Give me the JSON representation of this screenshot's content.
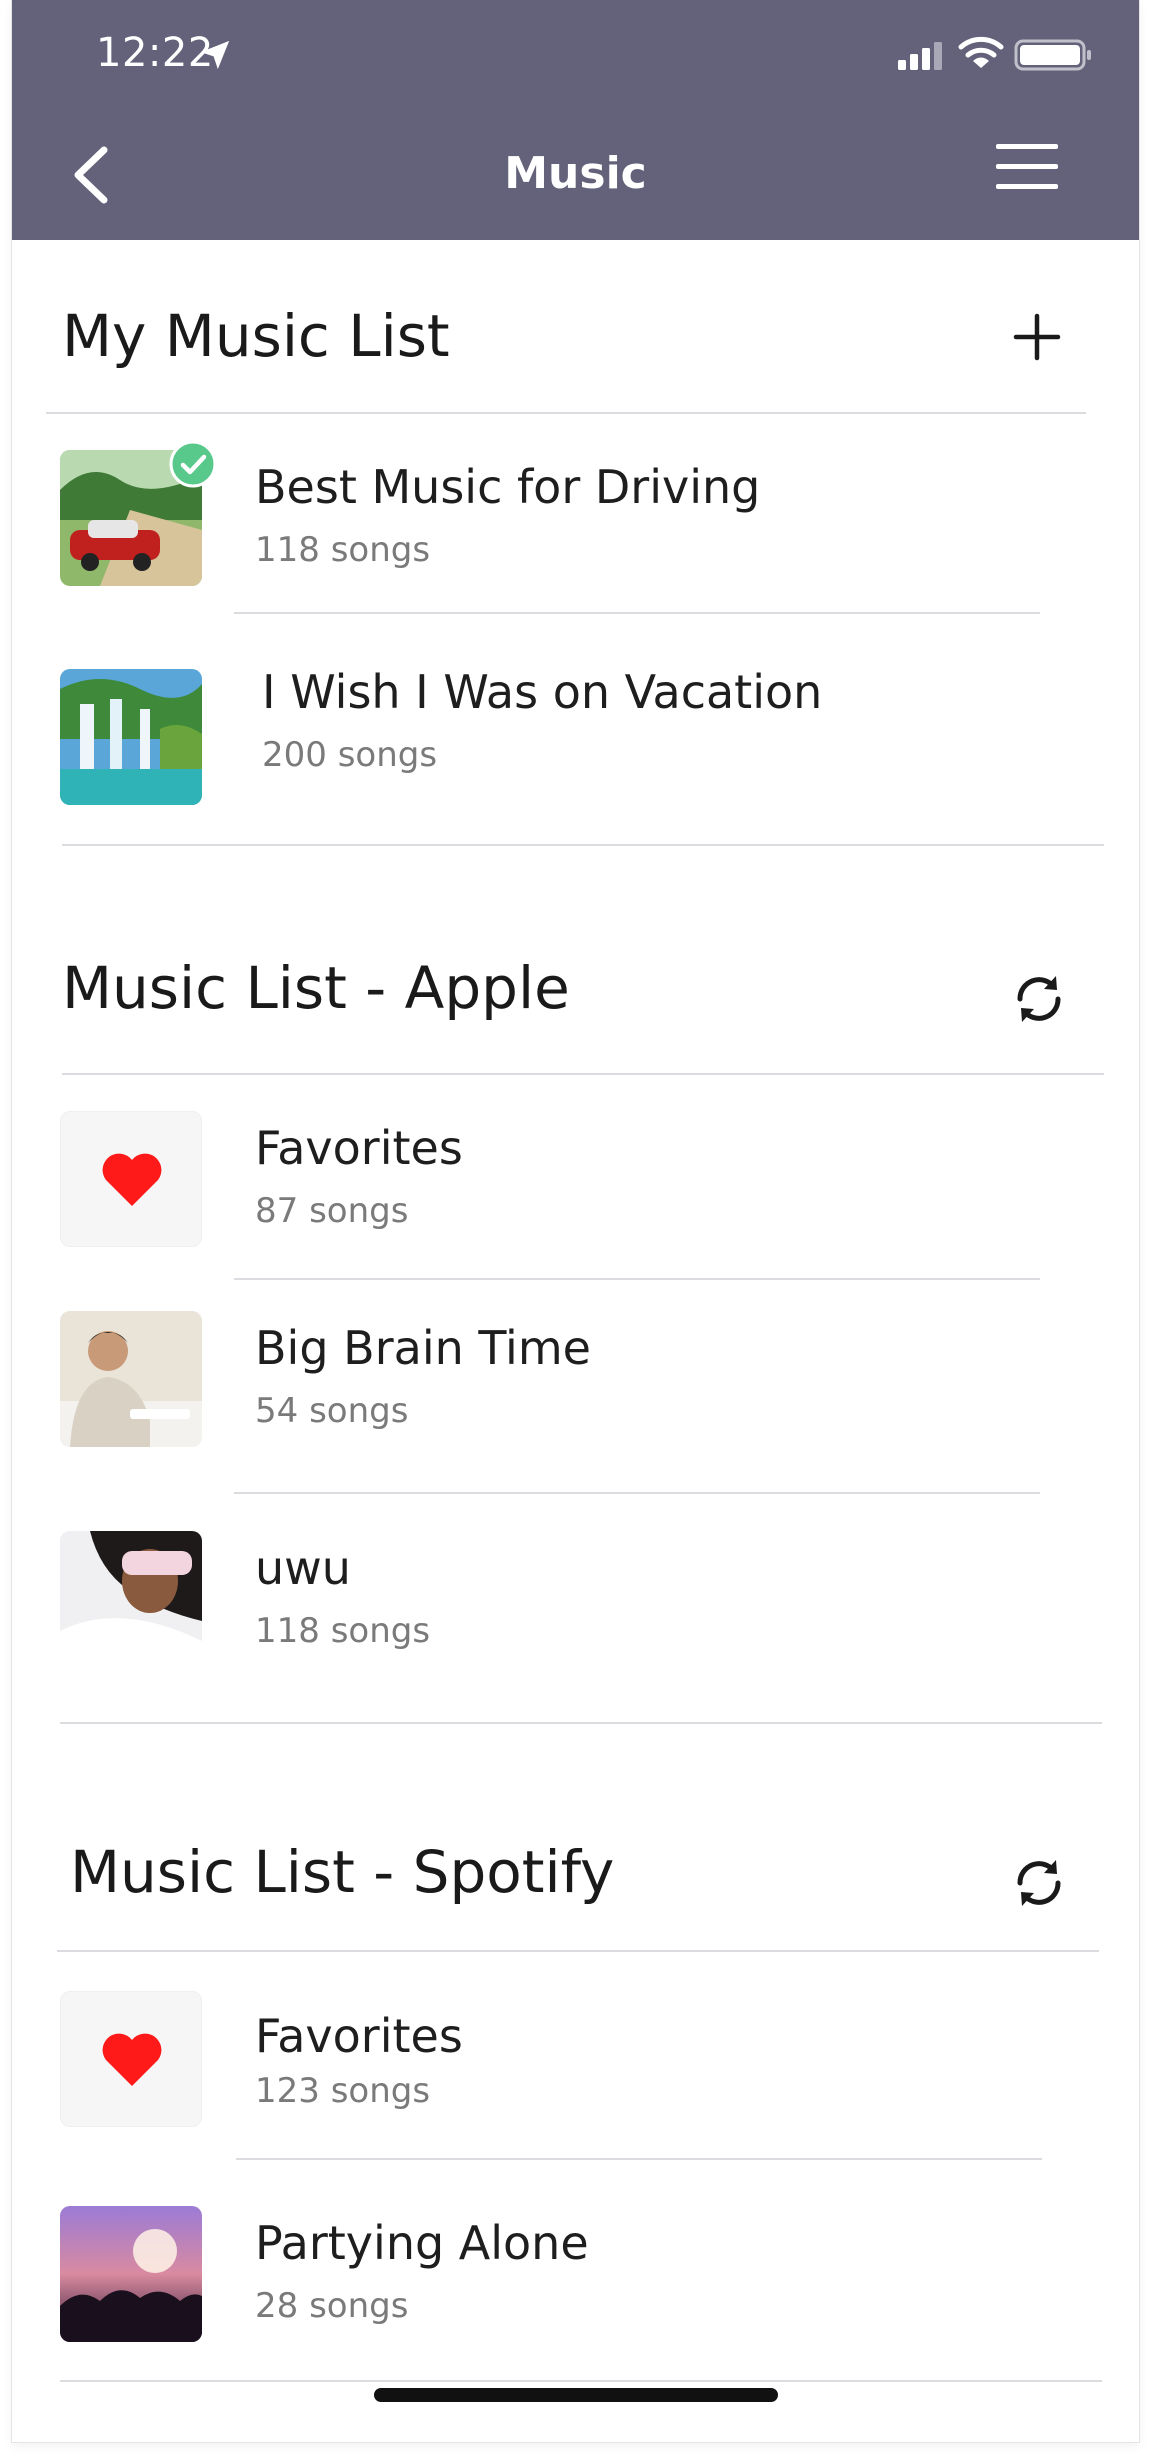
{
  "status_bar": {
    "time": "12:22"
  },
  "header": {
    "title": "Music"
  },
  "sections": {
    "my_list": {
      "title": "My Music List",
      "items": [
        {
          "title": "Best Music for Driving",
          "subtitle": "118 songs",
          "selected": true,
          "thumb": "vintage-car-photo"
        },
        {
          "title": "I Wish I Was on Vacation",
          "subtitle": "200 songs",
          "thumb": "waterfall-photo"
        }
      ]
    },
    "apple": {
      "title": "Music List - Apple",
      "items": [
        {
          "title": "Favorites",
          "subtitle": "87 songs",
          "thumb": "heart-icon"
        },
        {
          "title": "Big Brain Time",
          "subtitle": "54 songs",
          "thumb": "studying-man-photo"
        },
        {
          "title": "uwu",
          "subtitle": "118 songs",
          "thumb": "sleeping-woman-photo"
        }
      ]
    },
    "spotify": {
      "title": "Music List - Spotify",
      "items": [
        {
          "title": "Favorites",
          "subtitle": "123 songs",
          "thumb": "heart-icon"
        },
        {
          "title": "Partying Alone",
          "subtitle": "28 songs",
          "thumb": "concert-crowd-photo"
        }
      ]
    }
  },
  "colors": {
    "header_bg": "#63627a",
    "heart": "#ff1a1a",
    "check_badge": "#58c98a"
  }
}
